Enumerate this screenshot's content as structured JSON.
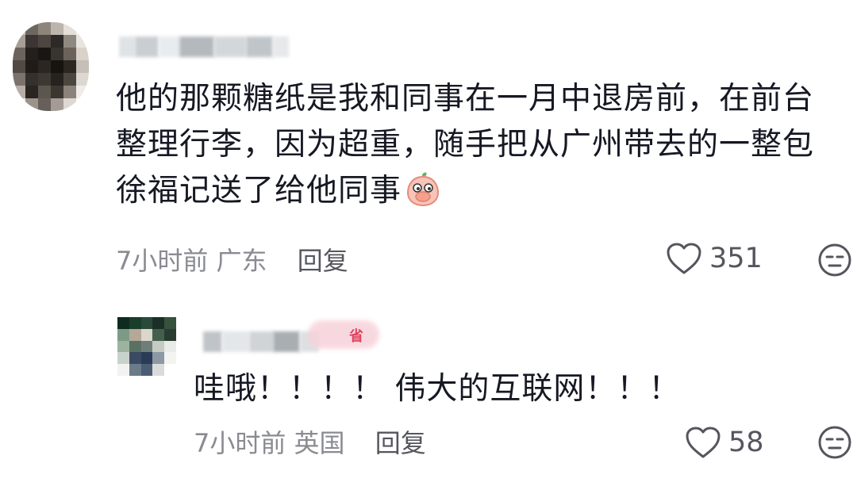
{
  "comments": [
    {
      "text_line1": "他的那颗糖纸是我和同事在一月中退房前，在前台",
      "text_line2": "整理行李，因为超重，随手把从广州带去的一整包",
      "text_line3": "徐福记送了给他同事",
      "emoji_icon": "peach-covering-mouth-emoji",
      "time": "7小时前",
      "location": "广东",
      "reply_label": "回复",
      "likes": "351"
    },
    {
      "text": "哇哦！！！！ 伟大的互联网！！！",
      "time": "7小时前",
      "location": "英国",
      "reply_label": "回复",
      "likes": "58"
    }
  ],
  "badge_text": "省",
  "colors": {
    "text": "#161823",
    "meta": "#8a8b91",
    "icon": "#55565d",
    "badge": "#f7d2da"
  }
}
